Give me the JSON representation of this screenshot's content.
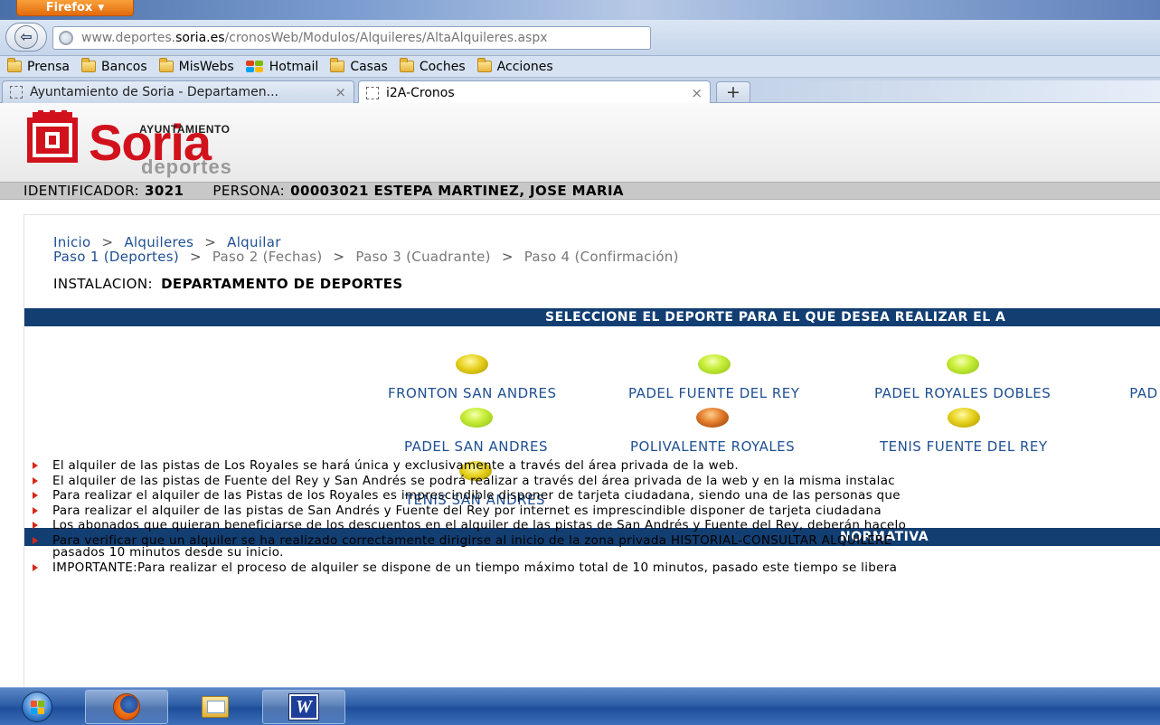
{
  "browser": {
    "menu_label": "Firefox",
    "url_prefix": "www.deportes.",
    "url_host": "soria.es",
    "url_path": "/cronosWeb/Modulos/Alquileres/AltaAlquileres.aspx",
    "bookmarks": [
      "Prensa",
      "Bancos",
      "MisWebs",
      "Hotmail",
      "Casas",
      "Coches",
      "Acciones"
    ],
    "tabs": [
      {
        "title": "Ayuntamiento de Soria - Departamen...",
        "active": false
      },
      {
        "title": "i2A-Cronos",
        "active": true
      }
    ],
    "new_tab_label": "+",
    "close_glyph": "×"
  },
  "logo": {
    "ayuntamiento": "AYUNTAMIENTO",
    "soria": "Soria",
    "deportes": "deportes"
  },
  "idbar": {
    "id_label": "IDENTIFICADOR:",
    "id_value": "3021",
    "persona_label": "PERSONA:",
    "persona_value": "00003021 ESTEPA MARTINEZ, JOSE MARIA"
  },
  "breadcrumb": {
    "inicio": "Inicio",
    "alquileres": "Alquileres",
    "alquilar": "Alquilar",
    "sep": ">",
    "steps": [
      "Paso 1 (Deportes)",
      "Paso 2 (Fechas)",
      "Paso 3 (Cuadrante)",
      "Paso 4 (Confirmación)"
    ]
  },
  "instalacion": {
    "label": "INSTALACION:",
    "value": "DEPARTAMENTO DE DEPORTES"
  },
  "select_header": "SELECCIONE EL DEPORTE PARA EL QUE DESEA REALIZAR EL A",
  "sports": [
    {
      "label": "FRONTON SAN ANDRES",
      "ball": "yellow"
    },
    {
      "label": "PADEL FUENTE DEL REY",
      "ball": "lime"
    },
    {
      "label": "PADEL ROYALES DOBLES",
      "ball": "lime"
    },
    {
      "label": "PAD",
      "ball": "none"
    },
    {
      "label": "PADEL SAN ANDRES",
      "ball": "lime"
    },
    {
      "label": "POLIVALENTE ROYALES",
      "ball": "orange"
    },
    {
      "label": "TENIS FUENTE DEL REY",
      "ball": "yellow"
    },
    {
      "label": "TENIS SAN ANDRES",
      "ball": "yellow"
    }
  ],
  "normativa_header": "NORMATIVA",
  "rules": [
    "El alquiler de las pistas de Los Royales se hará única y exclusivamente a través del área privada de la web.",
    "El alquiler de las pistas de Fuente del Rey y San Andrés se podrá realizar a través del área privada de la web y en la misma instalac",
    "Para realizar el alquiler de las Pistas de los Royales es imprescindible disponer de tarjeta ciudadana, siendo una de las personas que",
    "Para realizar el alquiler de las pistas de San Andrés y Fuente del Rey por internet es imprescindible disponer de tarjeta ciudadana",
    "Los abonados que quieran beneficiarse de los descuentos en el alquiler de las pistas de San Andrés y Fuente del Rey, deberán hacelo",
    "Para verificar que un alquiler se ha realizado correctamente dirigirse al inicio de la zona privada HISTORIAL-CONSULTAR ALQUILERE",
    "IMPORTANTE:Para realizar el proceso de alquiler se dispone de un tiempo máximo total de 10 minutos, pasado este tiempo se libera"
  ],
  "rule_6_line2": "pasados 10 minutos desde su inicio.",
  "taskbar": {
    "word_letter": "W"
  }
}
